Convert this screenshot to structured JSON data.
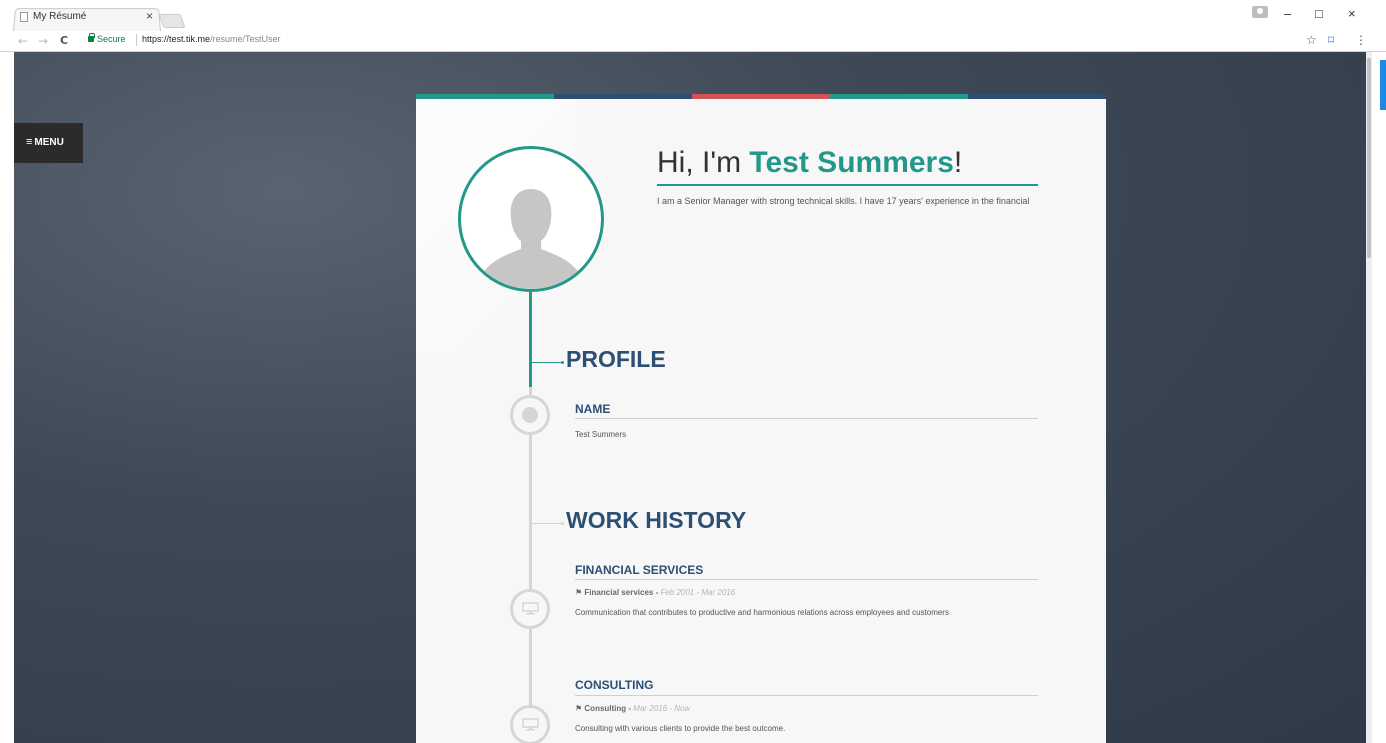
{
  "browser": {
    "tab_title": "My Résumé",
    "tab_close": "×",
    "secure_label": "Secure",
    "url_host": "https://test.tik.me",
    "url_path": "/resume/TestUser",
    "back": "←",
    "forward": "→",
    "reload": "C",
    "star": "☆",
    "extension": "⌑",
    "menu": "⋮",
    "minimize": "–",
    "maximize": "□",
    "close": "×"
  },
  "page": {
    "menu_icon": "≡",
    "menu_label": "MENU",
    "stripe_colors": [
      "#22978a",
      "#2c4f73",
      "#d25555",
      "#22978a",
      "#2c4f73"
    ],
    "accent": "#22978a",
    "heading_color": "#2c4f73"
  },
  "hero": {
    "greeting": "Hi, I'm ",
    "name": "Test Summers",
    "exclaim": "!",
    "intro": "I am a Senior Manager with strong technical skills. I have 17 years' experience in the financial"
  },
  "profile": {
    "title": "PROFILE",
    "field_label": "NAME",
    "field_value": "Test Summers"
  },
  "work": {
    "title": "WORK HISTORY",
    "items": [
      {
        "title": "FINANCIAL SERVICES",
        "company": "Financial services",
        "separator": " - ",
        "dates": "Feb 2001 - Mar 2016",
        "description": "Communication that contributes to productive and harmonious relations across employees and customers"
      },
      {
        "title": "CONSULTING",
        "company": "Consulting",
        "separator": " - ",
        "dates": "Mar 2016 - Now",
        "description": "Consulting with various clients to provide the best outcome."
      }
    ]
  }
}
